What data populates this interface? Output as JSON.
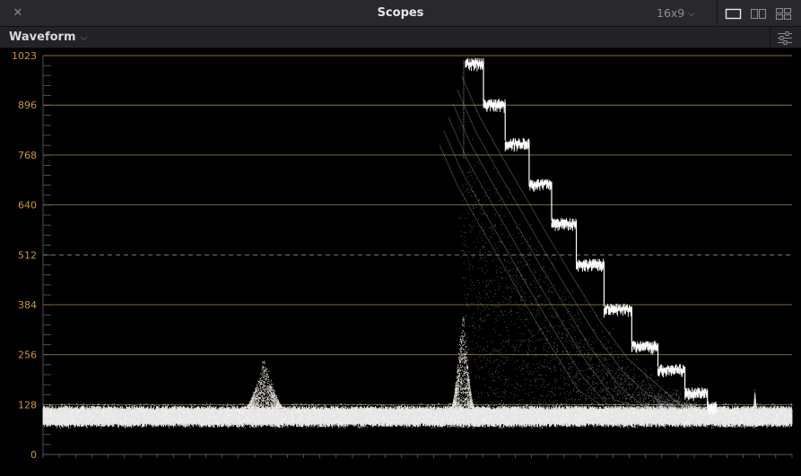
{
  "window": {
    "title": "Scopes",
    "close_glyph": "✕",
    "aspect": "16x9",
    "layouts": [
      "single-view-icon",
      "dual-view-icon",
      "quad-view-icon"
    ]
  },
  "toolbar": {
    "scope_type": "Waveform",
    "settings_icon": "sliders-icon"
  },
  "colors": {
    "background": "#000000",
    "graticule": "#8a7040",
    "label": "#c9963a",
    "trace": "#ffffff",
    "titlebar": "#29292d"
  },
  "chart_data": {
    "type": "waveform",
    "title": "",
    "xlabel": "",
    "ylabel": "",
    "ylim": [
      0,
      1023
    ],
    "y_ticks": [
      0,
      128,
      256,
      384,
      512,
      640,
      768,
      896,
      1023
    ],
    "dashed_lines": [
      512
    ],
    "grid": true,
    "features": [
      {
        "x_frac": [
          0.0,
          1.0
        ],
        "y_low": 75,
        "y_high": 120,
        "note": "noise floor band"
      },
      {
        "x_frac_center": 0.295,
        "peak": 255,
        "width_frac": 0.05
      },
      {
        "x_frac_center": 0.56,
        "peak": 390,
        "width_frac": 0.03
      },
      {
        "steps": [
          {
            "x_frac": 0.564,
            "level": 1010
          },
          {
            "x_frac": 0.588,
            "level": 905
          },
          {
            "x_frac": 0.617,
            "level": 805
          },
          {
            "x_frac": 0.649,
            "level": 700
          },
          {
            "x_frac": 0.679,
            "level": 600
          },
          {
            "x_frac": 0.712,
            "level": 495
          },
          {
            "x_frac": 0.749,
            "level": 380
          },
          {
            "x_frac": 0.786,
            "level": 285
          },
          {
            "x_frac": 0.821,
            "level": 225
          },
          {
            "x_frac": 0.857,
            "level": 165
          },
          {
            "x_frac": 0.887,
            "level": 130
          }
        ]
      },
      {
        "x_frac_center": 0.95,
        "peak": 165,
        "width_frac": 0.004
      }
    ]
  }
}
